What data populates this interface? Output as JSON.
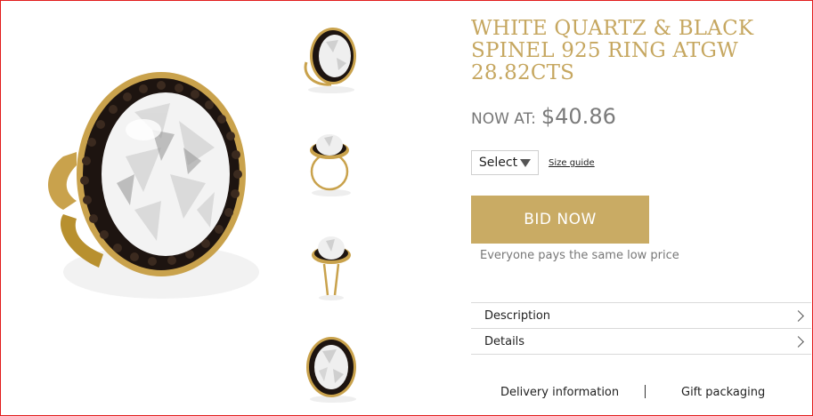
{
  "product": {
    "title": "WHITE QUARTZ & BLACK SPINEL 925 RING ATGW 28.82CTS",
    "price_label": "NOW AT:",
    "price_value": "$40.86"
  },
  "size": {
    "select_label": "Select",
    "guide_label": "Size guide"
  },
  "bid": {
    "button_label": "BID NOW",
    "note": "Everyone pays the same low price"
  },
  "accordion": [
    {
      "label": "Description"
    },
    {
      "label": "Details"
    }
  ],
  "footer": {
    "delivery_label": "Delivery information",
    "gift_label": "Gift packaging"
  },
  "colors": {
    "accent": "#c6a760",
    "button": "#c9ab64",
    "border": "#e21d1d"
  }
}
